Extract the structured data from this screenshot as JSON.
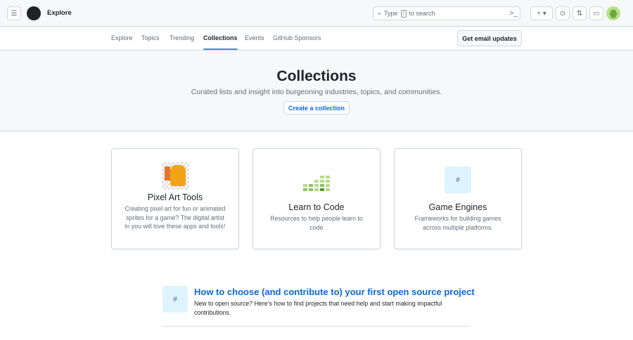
{
  "header": {
    "title": "Explore",
    "search_placeholder_pre": "Type",
    "search_key": "/",
    "search_placeholder_post": "to search"
  },
  "subnav": {
    "items": [
      "Explore",
      "Topics",
      "Trending",
      "Collections",
      "Events",
      "GitHub Sponsors"
    ],
    "active": "Collections",
    "email_button": "Get email updates"
  },
  "hero": {
    "title": "Collections",
    "subtitle": "Curated lists and insight into burgeoning industries, topics, and communities.",
    "create_button": "Create a collection"
  },
  "cards": [
    {
      "title": "Pixel Art Tools",
      "description": "Creating pixel art for fun or animated sprites for a game? The digital artist in you will love these apps and tools!"
    },
    {
      "title": "Learn to Code",
      "description": "Resources to help people learn to code"
    },
    {
      "title": "Game Engines",
      "description": "Frameworks for building games across multiple platforms.",
      "icon_text": "#"
    }
  ],
  "featured": {
    "icon_text": "#",
    "title": "How to choose (and contribute to) your first open source project",
    "description": "New to open source? Here’s how to find projects that need help and start making impactful contributions."
  }
}
